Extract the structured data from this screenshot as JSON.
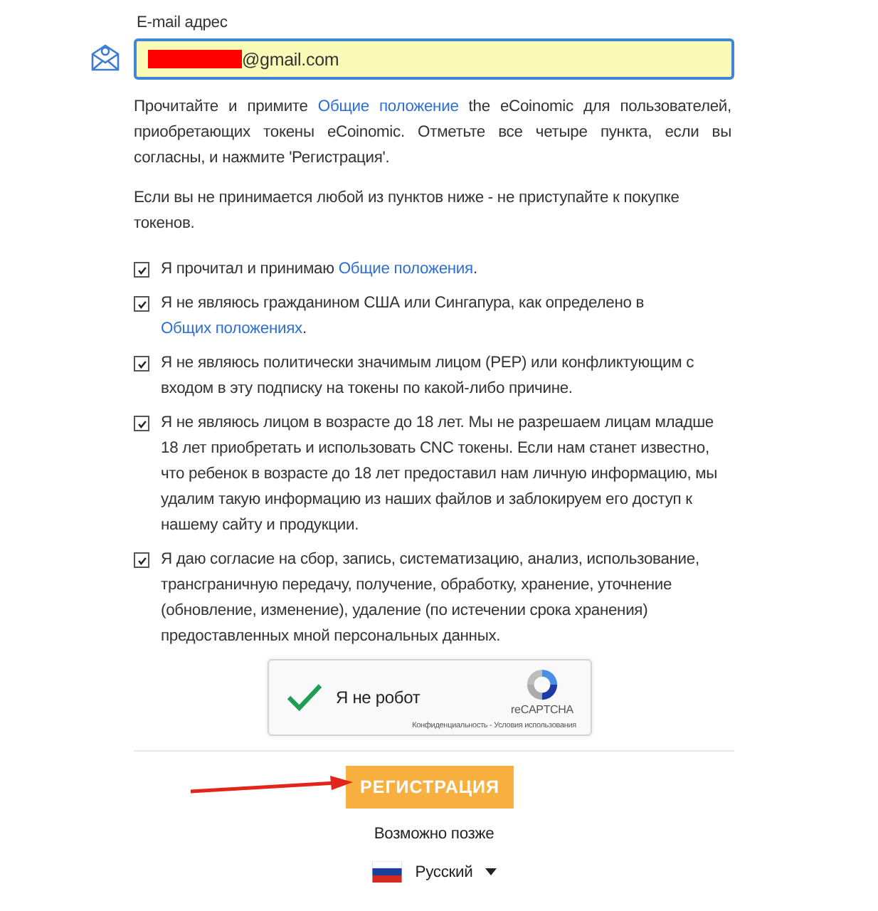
{
  "email": {
    "label": "E-mail адрес",
    "value": "@gmail.com",
    "redacted": true
  },
  "intro": [
    {
      "kind": "text",
      "text": "Прочитайте и примите "
    },
    {
      "kind": "link",
      "text": "Общие положение"
    },
    {
      "kind": "text",
      "text": " the eCoinomic для пользователей, приобретающих токены eCoinomic. Отметьте все четыре пункта, если вы согласны, и нажмите 'Регистрация'."
    }
  ],
  "warning": "Если вы не принимается любой из пунктов ниже - не приступайте к покупке токенов.",
  "agreements": [
    {
      "checked": true,
      "parts": [
        {
          "kind": "text",
          "text": "Я прочитал и принимаю "
        },
        {
          "kind": "link",
          "text": "Общие положения"
        },
        {
          "kind": "text",
          "text": "."
        }
      ]
    },
    {
      "checked": true,
      "parts": [
        {
          "kind": "text",
          "text": "Я не являюсь гражданином США или Сингапура, как определено в "
        },
        {
          "kind": "link",
          "text": "Общих положениях"
        },
        {
          "kind": "text",
          "text": "."
        }
      ]
    },
    {
      "checked": true,
      "parts": [
        {
          "kind": "text",
          "text": "Я не являюсь политически значимым лицом (PEP) или конфликтующим с входом в эту подписку на токены по какой-либо причине."
        }
      ]
    },
    {
      "checked": true,
      "parts": [
        {
          "kind": "text",
          "text": "Я не являюсь лицом в возрасте до 18 лет. Мы не разрешаем лицам младше 18 лет приобретать и использовать CNC токены. Если нам станет известно, что ребенок в возрасте до 18 лет предоставил нам личную информацию, мы удалим такую информацию из наших файлов и заблокируем его доступ к нашему сайту и продукции."
        }
      ]
    },
    {
      "checked": true,
      "parts": [
        {
          "kind": "text",
          "text": "Я даю согласие на сбор, запись, систематизацию, анализ, использование, трансграничную передачу, получение, обработку, хранение, уточнение (обновление, изменение), удаление (по истечении срока хранения) предоставленных мной персональных данных."
        }
      ]
    }
  ],
  "captcha": {
    "checked": true,
    "label": "Я не робот",
    "brand": "reCAPTCHA",
    "links": "Конфиденциальность - Условия использования"
  },
  "register_button": "РЕГИСТРАЦИЯ",
  "annotation_arrow": true,
  "later_link": "Возможно позже",
  "language": "Русский"
}
